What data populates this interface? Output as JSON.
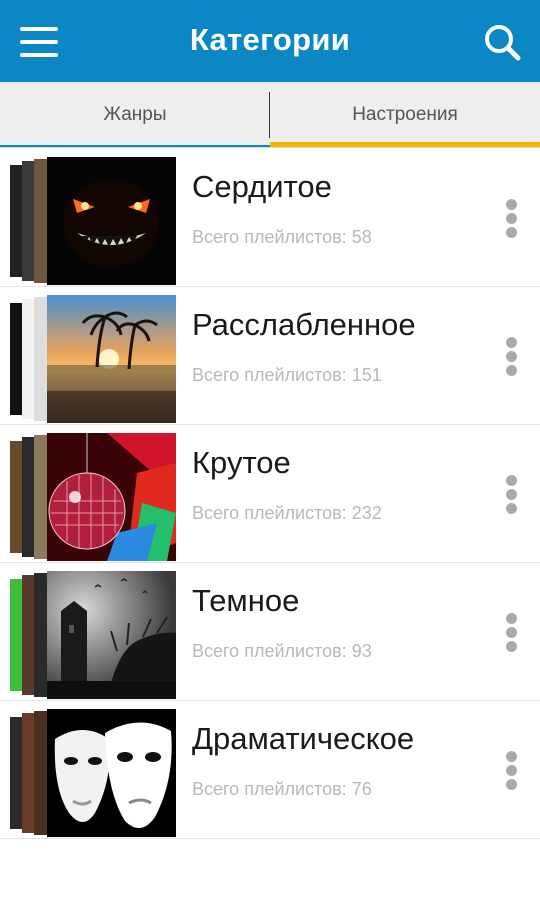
{
  "appbar": {
    "title": "Категории",
    "menu_icon": "hamburger-menu-icon",
    "search_icon": "search-icon",
    "color": "#0a87c4"
  },
  "tabs": [
    {
      "label": "Жанры",
      "selected": false
    },
    {
      "label": "Настроения",
      "selected": true
    }
  ],
  "tab_indicator_color": "#f4b400",
  "count_label": "Всего плейлистов:",
  "categories": [
    {
      "title": "Сердитое",
      "count": "58"
    },
    {
      "title": "Расслабленное",
      "count": "151"
    },
    {
      "title": "Крутое",
      "count": "232"
    },
    {
      "title": "Темное",
      "count": "93"
    },
    {
      "title": "Драматическое",
      "count": "76"
    }
  ]
}
